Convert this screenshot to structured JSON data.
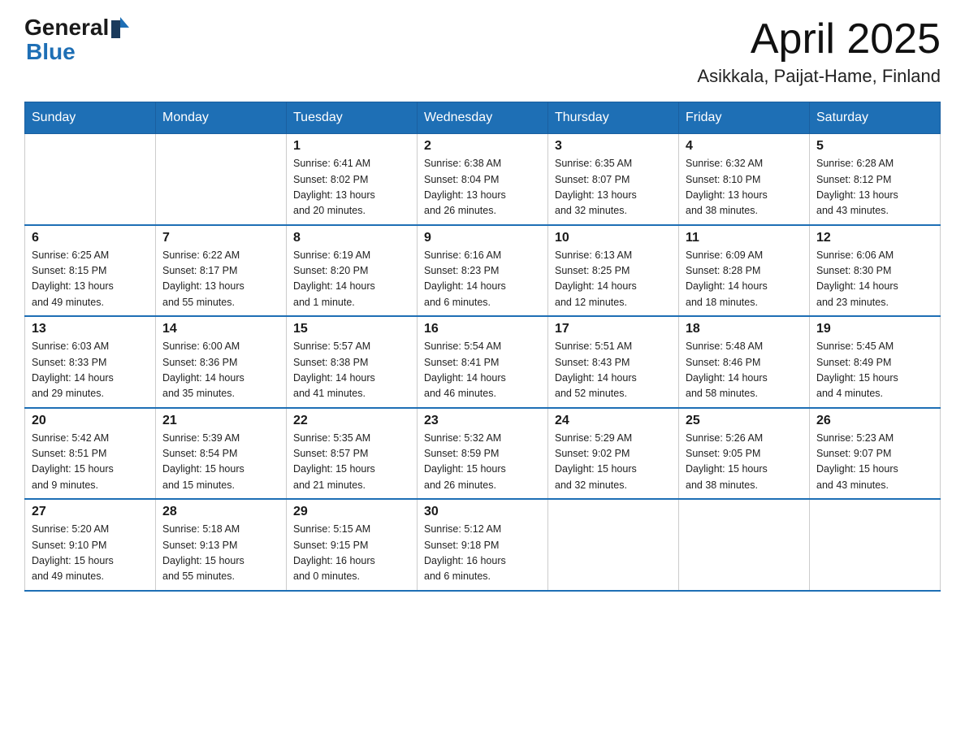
{
  "header": {
    "logo": {
      "line1": "General",
      "line2": "Blue"
    },
    "title": "April 2025",
    "subtitle": "Asikkala, Paijat-Hame, Finland"
  },
  "calendar": {
    "days_of_week": [
      "Sunday",
      "Monday",
      "Tuesday",
      "Wednesday",
      "Thursday",
      "Friday",
      "Saturday"
    ],
    "weeks": [
      [
        {
          "day": "",
          "info": ""
        },
        {
          "day": "",
          "info": ""
        },
        {
          "day": "1",
          "info": "Sunrise: 6:41 AM\nSunset: 8:02 PM\nDaylight: 13 hours\nand 20 minutes."
        },
        {
          "day": "2",
          "info": "Sunrise: 6:38 AM\nSunset: 8:04 PM\nDaylight: 13 hours\nand 26 minutes."
        },
        {
          "day": "3",
          "info": "Sunrise: 6:35 AM\nSunset: 8:07 PM\nDaylight: 13 hours\nand 32 minutes."
        },
        {
          "day": "4",
          "info": "Sunrise: 6:32 AM\nSunset: 8:10 PM\nDaylight: 13 hours\nand 38 minutes."
        },
        {
          "day": "5",
          "info": "Sunrise: 6:28 AM\nSunset: 8:12 PM\nDaylight: 13 hours\nand 43 minutes."
        }
      ],
      [
        {
          "day": "6",
          "info": "Sunrise: 6:25 AM\nSunset: 8:15 PM\nDaylight: 13 hours\nand 49 minutes."
        },
        {
          "day": "7",
          "info": "Sunrise: 6:22 AM\nSunset: 8:17 PM\nDaylight: 13 hours\nand 55 minutes."
        },
        {
          "day": "8",
          "info": "Sunrise: 6:19 AM\nSunset: 8:20 PM\nDaylight: 14 hours\nand 1 minute."
        },
        {
          "day": "9",
          "info": "Sunrise: 6:16 AM\nSunset: 8:23 PM\nDaylight: 14 hours\nand 6 minutes."
        },
        {
          "day": "10",
          "info": "Sunrise: 6:13 AM\nSunset: 8:25 PM\nDaylight: 14 hours\nand 12 minutes."
        },
        {
          "day": "11",
          "info": "Sunrise: 6:09 AM\nSunset: 8:28 PM\nDaylight: 14 hours\nand 18 minutes."
        },
        {
          "day": "12",
          "info": "Sunrise: 6:06 AM\nSunset: 8:30 PM\nDaylight: 14 hours\nand 23 minutes."
        }
      ],
      [
        {
          "day": "13",
          "info": "Sunrise: 6:03 AM\nSunset: 8:33 PM\nDaylight: 14 hours\nand 29 minutes."
        },
        {
          "day": "14",
          "info": "Sunrise: 6:00 AM\nSunset: 8:36 PM\nDaylight: 14 hours\nand 35 minutes."
        },
        {
          "day": "15",
          "info": "Sunrise: 5:57 AM\nSunset: 8:38 PM\nDaylight: 14 hours\nand 41 minutes."
        },
        {
          "day": "16",
          "info": "Sunrise: 5:54 AM\nSunset: 8:41 PM\nDaylight: 14 hours\nand 46 minutes."
        },
        {
          "day": "17",
          "info": "Sunrise: 5:51 AM\nSunset: 8:43 PM\nDaylight: 14 hours\nand 52 minutes."
        },
        {
          "day": "18",
          "info": "Sunrise: 5:48 AM\nSunset: 8:46 PM\nDaylight: 14 hours\nand 58 minutes."
        },
        {
          "day": "19",
          "info": "Sunrise: 5:45 AM\nSunset: 8:49 PM\nDaylight: 15 hours\nand 4 minutes."
        }
      ],
      [
        {
          "day": "20",
          "info": "Sunrise: 5:42 AM\nSunset: 8:51 PM\nDaylight: 15 hours\nand 9 minutes."
        },
        {
          "day": "21",
          "info": "Sunrise: 5:39 AM\nSunset: 8:54 PM\nDaylight: 15 hours\nand 15 minutes."
        },
        {
          "day": "22",
          "info": "Sunrise: 5:35 AM\nSunset: 8:57 PM\nDaylight: 15 hours\nand 21 minutes."
        },
        {
          "day": "23",
          "info": "Sunrise: 5:32 AM\nSunset: 8:59 PM\nDaylight: 15 hours\nand 26 minutes."
        },
        {
          "day": "24",
          "info": "Sunrise: 5:29 AM\nSunset: 9:02 PM\nDaylight: 15 hours\nand 32 minutes."
        },
        {
          "day": "25",
          "info": "Sunrise: 5:26 AM\nSunset: 9:05 PM\nDaylight: 15 hours\nand 38 minutes."
        },
        {
          "day": "26",
          "info": "Sunrise: 5:23 AM\nSunset: 9:07 PM\nDaylight: 15 hours\nand 43 minutes."
        }
      ],
      [
        {
          "day": "27",
          "info": "Sunrise: 5:20 AM\nSunset: 9:10 PM\nDaylight: 15 hours\nand 49 minutes."
        },
        {
          "day": "28",
          "info": "Sunrise: 5:18 AM\nSunset: 9:13 PM\nDaylight: 15 hours\nand 55 minutes."
        },
        {
          "day": "29",
          "info": "Sunrise: 5:15 AM\nSunset: 9:15 PM\nDaylight: 16 hours\nand 0 minutes."
        },
        {
          "day": "30",
          "info": "Sunrise: 5:12 AM\nSunset: 9:18 PM\nDaylight: 16 hours\nand 6 minutes."
        },
        {
          "day": "",
          "info": ""
        },
        {
          "day": "",
          "info": ""
        },
        {
          "day": "",
          "info": ""
        }
      ]
    ]
  }
}
